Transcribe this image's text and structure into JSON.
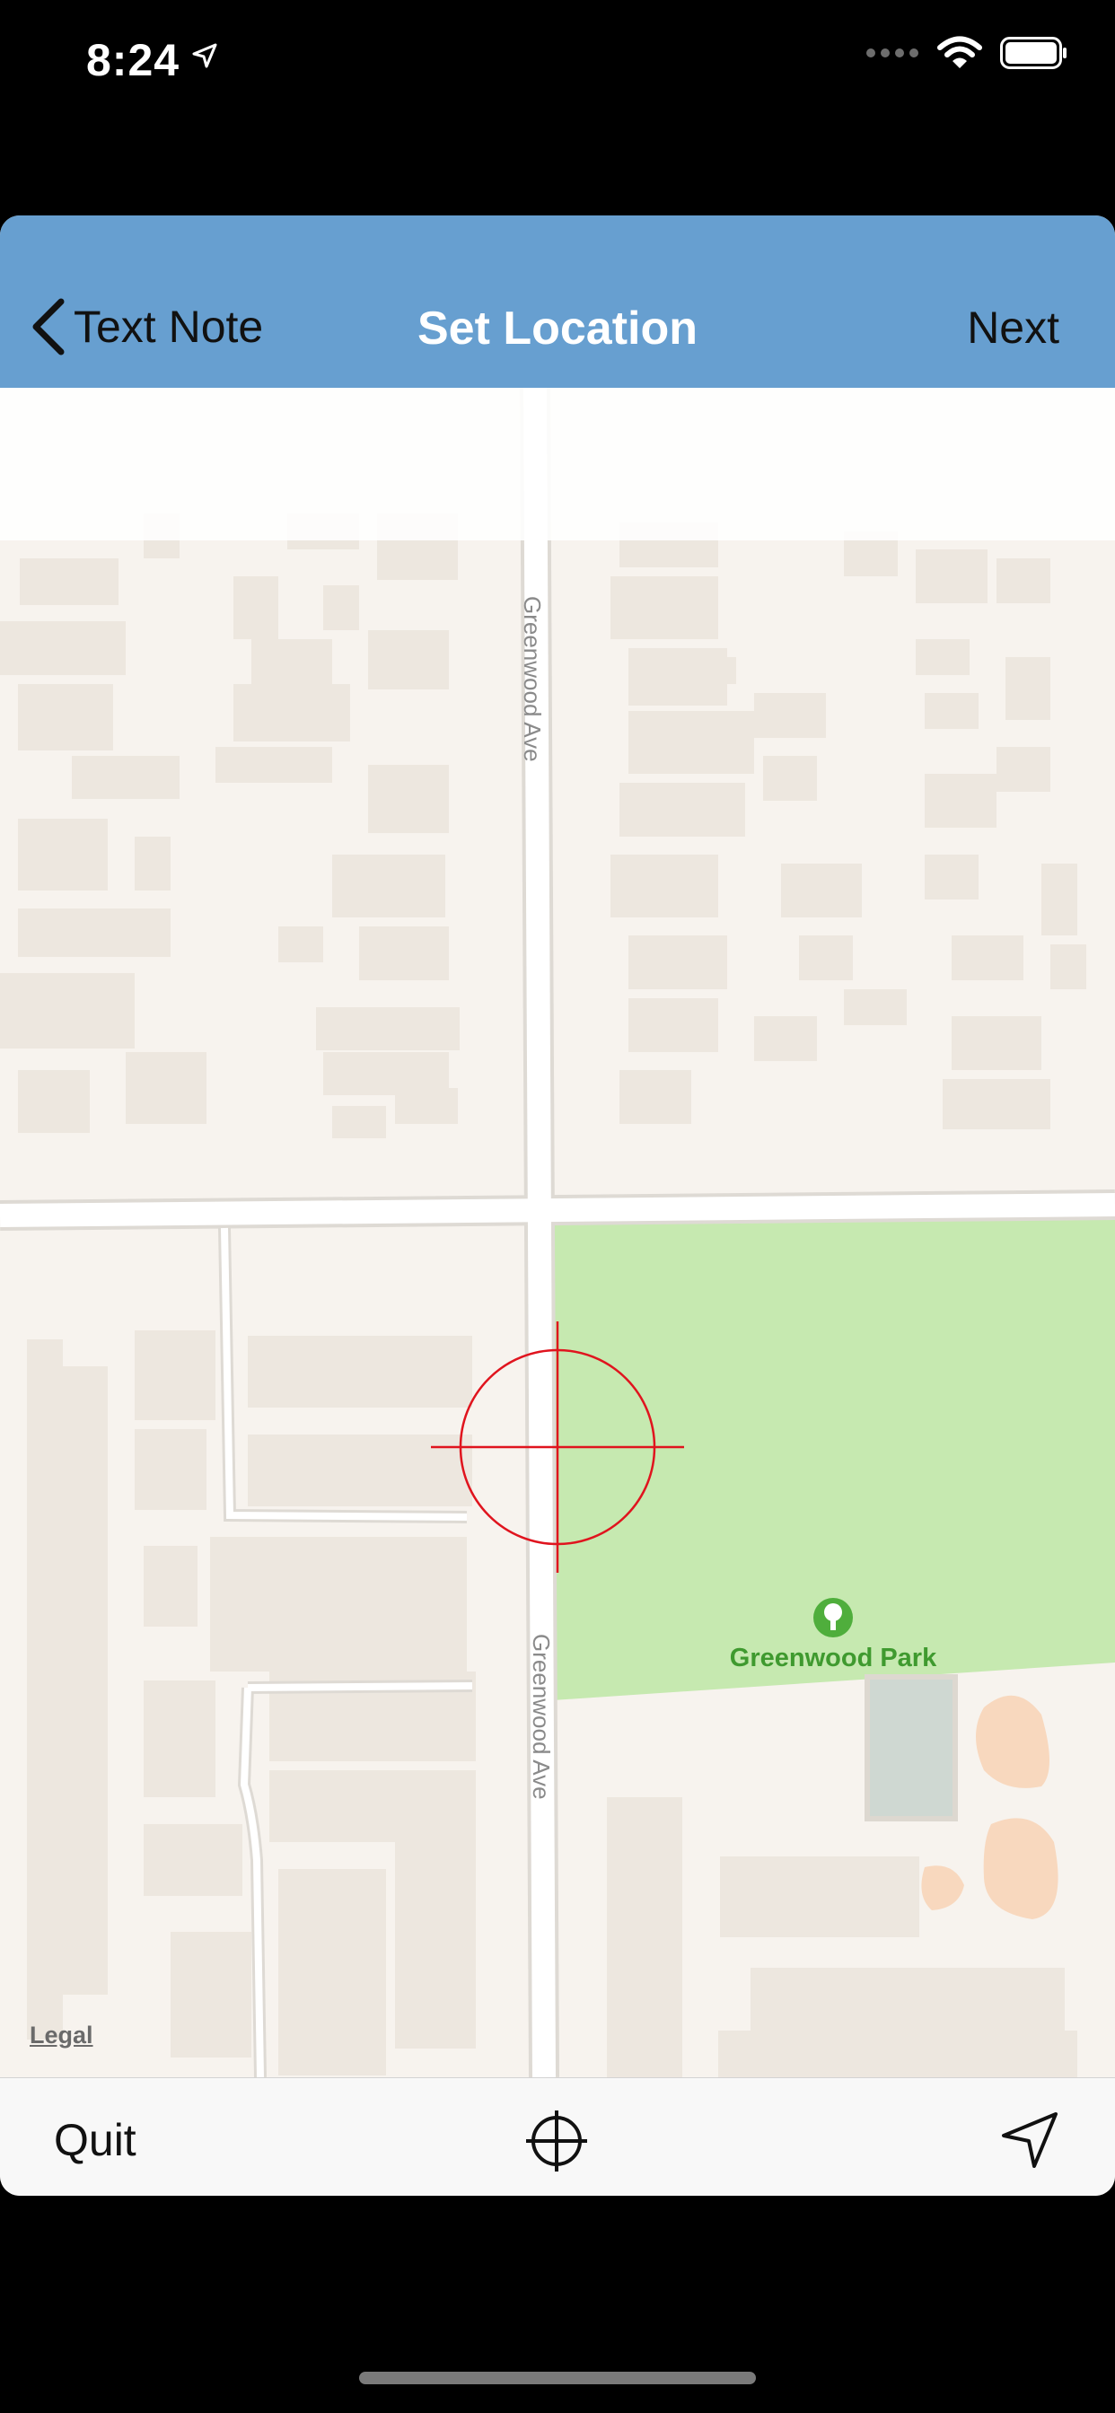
{
  "status_bar": {
    "time": "8:24",
    "icons": [
      "location-arrow-icon",
      "signal-dots-icon",
      "wifi-icon",
      "battery-icon"
    ]
  },
  "navbar": {
    "back_label": "Text Note",
    "title": "Set Location",
    "next_label": "Next",
    "background_color": "#679fd0"
  },
  "map": {
    "street_labels": [
      "Greenwood Ave",
      "Greenwood Ave"
    ],
    "park_name": "Greenwood Park",
    "legal_label": "Legal",
    "park_color": "#c6e9b0",
    "crosshair_color": "#e0141e"
  },
  "toolbar": {
    "quit_label": "Quit",
    "center_icon": "crosshair-icon",
    "locate_icon": "navigation-arrow-icon"
  }
}
